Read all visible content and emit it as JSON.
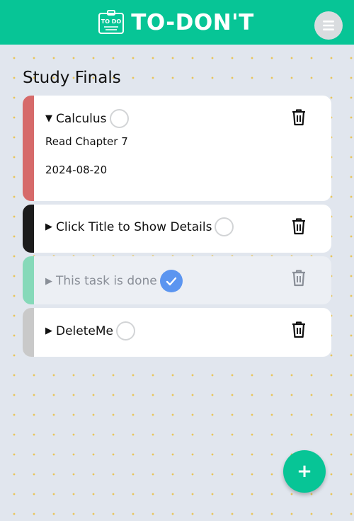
{
  "app": {
    "title": "TO-DON'T",
    "logo_text": "TO DO"
  },
  "list": {
    "title": "Study Finals"
  },
  "tasks": [
    {
      "title": "Calculus",
      "arrow": "▼",
      "expanded": true,
      "done": false,
      "description": "Read Chapter 7",
      "due_date": "2024-08-20",
      "color": "#d66a6a"
    },
    {
      "title": "Click Title to Show Details",
      "arrow": "▶",
      "expanded": false,
      "done": false,
      "color": "#1c1c1c"
    },
    {
      "title": "This task is done",
      "arrow": "▶",
      "expanded": false,
      "done": true,
      "color": "#86d9b9"
    },
    {
      "title": "DeleteMe",
      "arrow": "▶",
      "expanded": false,
      "done": false,
      "color": "#c9c9c9"
    }
  ],
  "fab": {
    "label": "+"
  },
  "colors": {
    "brand": "#07c596",
    "done_check": "#5b95f0",
    "background": "#e1e6ee"
  },
  "icons": {
    "menu": "hamburger-icon",
    "delete": "trash-icon",
    "add": "plus-icon",
    "check": "check-icon",
    "logo": "todo-clipboard-icon"
  }
}
